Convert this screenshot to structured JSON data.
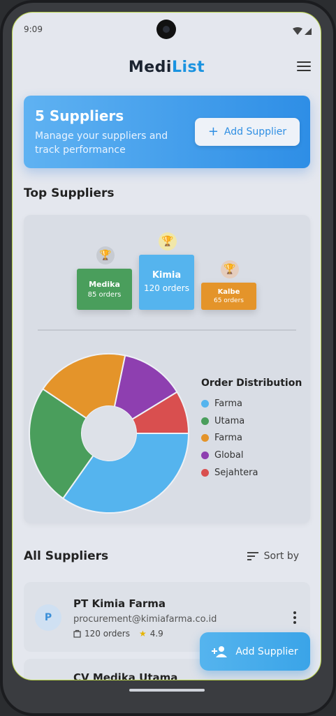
{
  "status_bar": {
    "time": "9:09"
  },
  "app": {
    "logo_part1": "Medi",
    "logo_part2": "List"
  },
  "hero": {
    "title": "5 Suppliers",
    "subtitle": "Manage your suppliers and track performance",
    "add_button": "Add Supplier"
  },
  "top_suppliers": {
    "title": "Top Suppliers",
    "podium": [
      {
        "rank": 2,
        "name": "Medika",
        "orders": "85 orders",
        "color": "#4a9e5c",
        "trophy_color": "#9ea3aa"
      },
      {
        "rank": 1,
        "name": "Kimia",
        "orders": "120 orders",
        "color": "#55b4ee",
        "trophy_color": "#e6c640"
      },
      {
        "rank": 3,
        "name": "Kalbe",
        "orders": "65 orders",
        "color": "#e4942a",
        "trophy_color": "#c58a5a"
      }
    ]
  },
  "chart_data": {
    "type": "pie",
    "title": "Order Distribution",
    "labels": [
      "Farma",
      "Utama",
      "Farma",
      "Global",
      "Sejahtera"
    ],
    "values": [
      120,
      85,
      65,
      45,
      30
    ],
    "colors": [
      "#55b4ee",
      "#4a9e5c",
      "#e4942a",
      "#8e3fb0",
      "#d94f4f"
    ],
    "legend_position": "right"
  },
  "all_suppliers": {
    "title": "All Suppliers",
    "sort_label": "Sort by",
    "items": [
      {
        "initial": "P",
        "name": "PT Kimia Farma",
        "email": "procurement@kimiafarma.co.id",
        "orders": "120 orders",
        "rating": "4.9"
      },
      {
        "name": "CV Medika Utama"
      }
    ]
  },
  "fab": {
    "label": "Add Supplier"
  }
}
